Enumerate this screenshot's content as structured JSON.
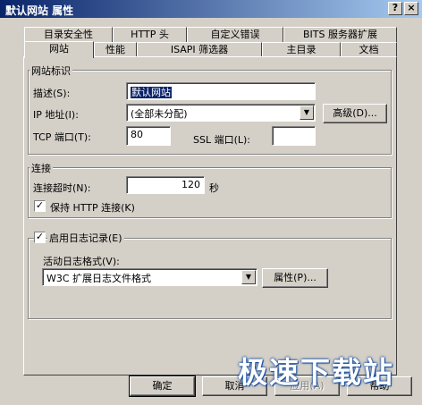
{
  "window": {
    "title": "默认网站 属性",
    "help_glyph": "?",
    "close_glyph": "×"
  },
  "tabs_back": [
    "目录安全性",
    "HTTP 头",
    "自定义错误",
    "BITS 服务器扩展"
  ],
  "tabs_front": [
    "网站",
    "性能",
    "ISAPI 筛选器",
    "主目录",
    "文档"
  ],
  "site_id": {
    "title": "网站标识",
    "desc_label": "描述(S):",
    "desc_value": "默认网站",
    "ip_label": "IP 地址(I):",
    "ip_value": "(全部未分配)",
    "advanced_label": "高级(D)...",
    "tcp_label": "TCP 端口(T):",
    "tcp_value": "80",
    "ssl_label": "SSL 端口(L):",
    "ssl_value": ""
  },
  "connection": {
    "title": "连接",
    "timeout_label": "连接超时(N):",
    "timeout_value": "120",
    "timeout_unit": "秒",
    "keepalive_label": "保持 HTTP 连接(K)",
    "keepalive_checked": true
  },
  "logging": {
    "enable_label": "启用日志记录(E)",
    "enable_checked": true,
    "format_label": "活动日志格式(V):",
    "format_value": "W3C 扩展日志文件格式",
    "props_label": "属性(P)..."
  },
  "footer": {
    "ok": "确定",
    "cancel": "取消",
    "apply": "应用(A)",
    "help": "帮助"
  },
  "watermark": "极速下载站",
  "check_glyph": "✓",
  "arrow_glyph": "▼"
}
